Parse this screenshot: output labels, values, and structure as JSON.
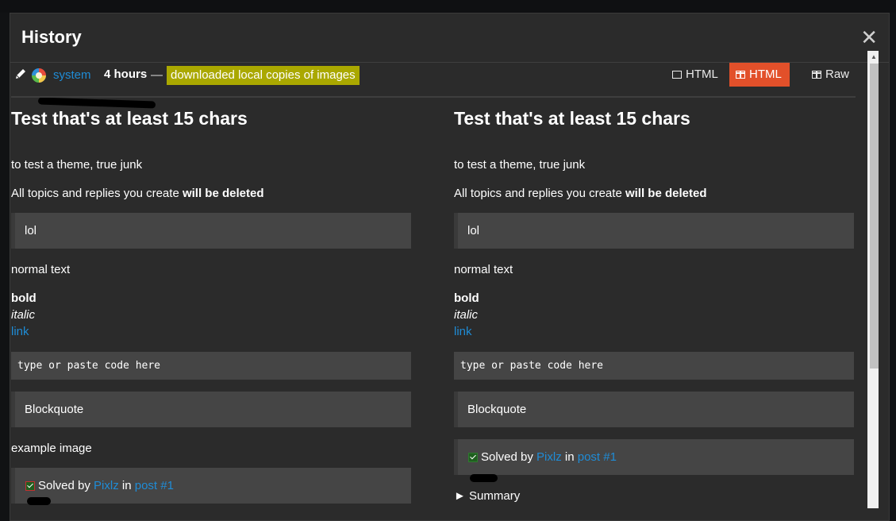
{
  "modal": {
    "title": "History",
    "close_glyph": "✕"
  },
  "revision": {
    "username": "system",
    "time": "4 hours",
    "separator": "—",
    "reason": "downloaded local copies of images"
  },
  "view_toggles": {
    "inline_label": "HTML",
    "side_by_side_label": "HTML",
    "raw_label": "Raw",
    "active": "side_by_side",
    "active_color": "#e2502a"
  },
  "left": {
    "title": "Test that's at least 15 chars",
    "subtitle": "to test a theme, true junk",
    "warning_prefix": "All topics and replies you create ",
    "warning_bold": "will be deleted",
    "quote1": "lol",
    "normal_text": "normal text",
    "bold_text": "bold",
    "italic_text": "italic",
    "link_text": "link",
    "code_placeholder": "type or paste code here",
    "quote2": "Blockquote",
    "image_label": "example image",
    "solved_prefix": "Solved by ",
    "solved_user": "Pixlz",
    "solved_in": " in ",
    "solved_post": "post #1"
  },
  "right": {
    "title": "Test that's at least 15 chars",
    "subtitle": "to test a theme, true junk",
    "warning_prefix": "All topics and replies you create ",
    "warning_bold": "will be deleted",
    "quote1": "lol",
    "normal_text": "normal text",
    "bold_text": "bold",
    "italic_text": "italic",
    "link_text": "link",
    "code_placeholder": "type or paste code here",
    "quote2": "Blockquote",
    "solved_prefix": "Solved by ",
    "solved_user": "Pixlz",
    "solved_in": " in ",
    "solved_post": "post #1",
    "summary_label": "► Summary"
  },
  "colors": {
    "link": "#1f8cd6",
    "reason_bg": "#aaa800",
    "modal_bg": "#2b2b2b"
  }
}
